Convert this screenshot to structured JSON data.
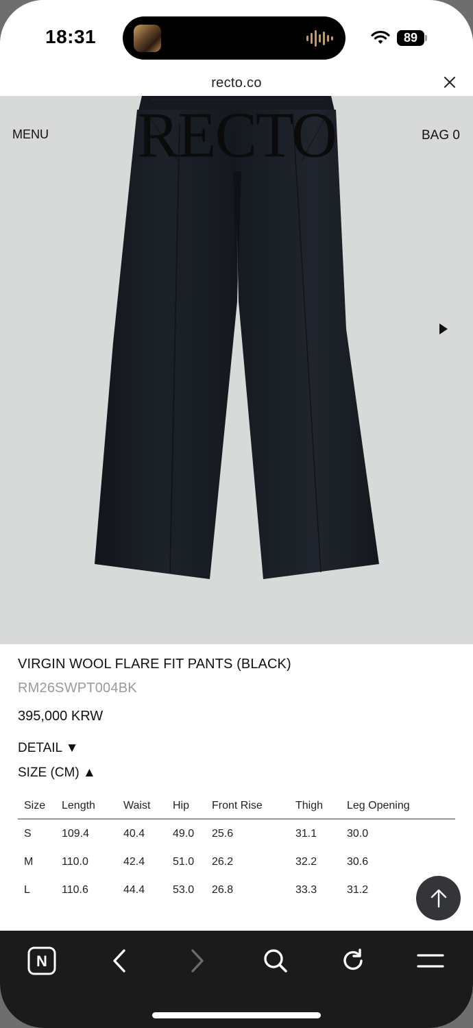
{
  "status_bar": {
    "time": "18:31",
    "battery": "89",
    "icons": [
      "now-playing-artwork",
      "audio-wave-icon",
      "wifi-icon",
      "battery-icon"
    ]
  },
  "browser": {
    "url": "recto.co"
  },
  "header": {
    "logo": "RECTO",
    "menu": "MENU",
    "bag": "BAG 0"
  },
  "product": {
    "title": "VIRGIN WOOL FLARE FIT PANTS (BLACK)",
    "sku": "RM26SWPT004BK",
    "price": "395,000 KRW",
    "detail_toggle": "DETAIL ▼",
    "size_toggle": "SIZE (CM) ▲"
  },
  "size_table": {
    "headers": [
      "Size",
      "Length",
      "Waist",
      "Hip",
      "Front Rise",
      "Thigh",
      "Leg Opening"
    ],
    "rows": [
      [
        "S",
        "109.4",
        "40.4",
        "49.0",
        "25.6",
        "31.1",
        "30.0"
      ],
      [
        "M",
        "110.0",
        "42.4",
        "51.0",
        "26.2",
        "32.2",
        "30.6"
      ],
      [
        "L",
        "110.6",
        "44.4",
        "53.0",
        "26.8",
        "33.3",
        "31.2"
      ]
    ]
  },
  "toolbar": {
    "home_logo": "N",
    "icons": [
      "naver-home-icon",
      "back-icon",
      "forward-icon",
      "search-icon",
      "reload-icon",
      "menu-icon"
    ]
  },
  "colors": {
    "hero_bg": "#d8d9d9",
    "toolbar_bg": "#1b1b1b",
    "sku_gray": "#9a9a9a",
    "scroll_top_bg": "#333538"
  }
}
